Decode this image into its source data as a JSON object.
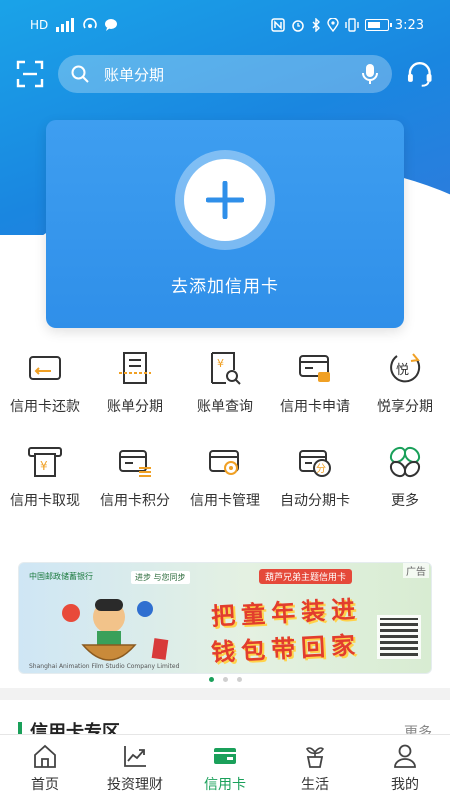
{
  "colors": {
    "primary_green": "#1aa05a",
    "hero_blue": "#1a86e0",
    "card_blue": "#3e9ef0",
    "icon_dark": "#333333",
    "icon_accent": "#f0a024"
  },
  "status_bar": {
    "time": "3:23",
    "left_icons": [
      "hd-icon",
      "4g-signal-icon",
      "hotspot-icon",
      "message-icon"
    ],
    "right_icons": [
      "nfc-icon",
      "alarm-icon",
      "bluetooth-icon",
      "location-icon",
      "vibrate-icon",
      "battery-icon"
    ]
  },
  "header": {
    "search_placeholder": "账单分期",
    "scan_icon": "scan-icon",
    "voice_icon": "microphone-icon",
    "service_icon": "headset-icon"
  },
  "card_panel": {
    "add_label": "去添加信用卡"
  },
  "services": [
    {
      "id": "repay",
      "label": "信用卡还款",
      "icon": "card-repay-icon"
    },
    {
      "id": "installment",
      "label": "账单分期",
      "icon": "bill-installment-icon"
    },
    {
      "id": "bill-query",
      "label": "账单查询",
      "icon": "bill-query-icon"
    },
    {
      "id": "apply",
      "label": "信用卡申请",
      "icon": "card-apply-icon"
    },
    {
      "id": "yuexiang",
      "label": "悦享分期",
      "icon": "yue-installment-icon",
      "badge": "悦"
    },
    {
      "id": "cash",
      "label": "信用卡取现",
      "icon": "cash-withdraw-icon"
    },
    {
      "id": "points",
      "label": "信用卡积分",
      "icon": "card-points-icon"
    },
    {
      "id": "manage",
      "label": "信用卡管理",
      "icon": "card-manage-icon"
    },
    {
      "id": "auto-installment",
      "label": "自动分期卡",
      "icon": "auto-installment-icon",
      "badge": "分"
    },
    {
      "id": "more",
      "label": "更多",
      "icon": "more-grid-icon"
    }
  ],
  "banner": {
    "ad_tag": "广告",
    "bank_name": "中国邮政储蓄银行",
    "slogan": "进步 与您同步",
    "theme": "葫芦兄弟主题信用卡",
    "headline_1": "把童年装进",
    "headline_2": "钱包带回家",
    "credit": "Shanghai Animation Film Studio Company Limited",
    "pages": 3,
    "active_page": 1
  },
  "section": {
    "title": "信用卡专区",
    "more": "更多"
  },
  "tabbar": [
    {
      "label": "首页",
      "icon": "home-icon",
      "active": false
    },
    {
      "label": "投资理财",
      "icon": "investment-chart-icon",
      "active": false
    },
    {
      "label": "信用卡",
      "icon": "credit-card-icon",
      "active": true
    },
    {
      "label": "生活",
      "icon": "plant-pot-icon",
      "active": false
    },
    {
      "label": "我的",
      "icon": "user-icon",
      "active": false
    }
  ]
}
